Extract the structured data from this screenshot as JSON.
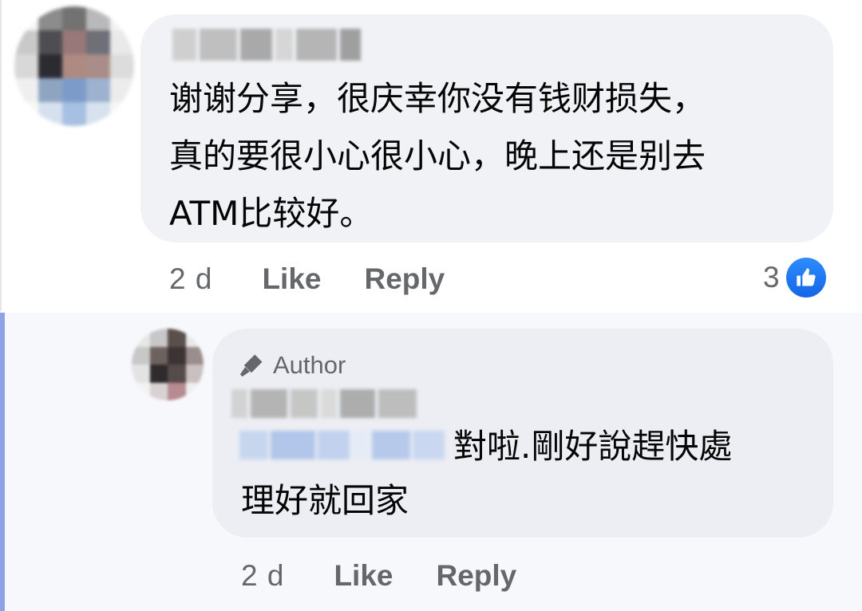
{
  "comment": {
    "text": "谢谢分享，很庆幸你没有钱财损失，\n真的要很小心很小心，晚上还是别去\nATM比较好。",
    "time": "2 d",
    "like_label": "Like",
    "reply_label": "Reply",
    "reaction_count": "3",
    "reaction_icon": "like-thumbs-up-icon"
  },
  "reply": {
    "badge_label": "Author",
    "badge_icon": "microphone-icon",
    "text_line1": "對啦.剛好說趕快處",
    "text_line2": "理好就回家",
    "time": "2 d",
    "like_label": "Like",
    "reply_label": "Reply"
  },
  "colors": {
    "bubble_bg": "#f0f2f5",
    "secondary_text": "#65676b",
    "like_blue": "#1877f2",
    "thread_accent": "#8ea2e6"
  }
}
